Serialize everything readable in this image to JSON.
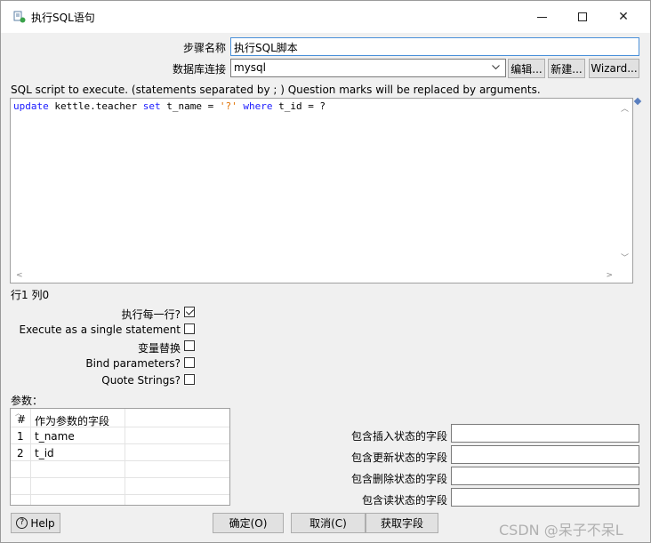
{
  "window": {
    "title": "执行SQL语句",
    "minimize_glyph": "—",
    "close_glyph": "✕"
  },
  "form": {
    "step_name_label": "步骤名称",
    "step_name_value": "执行SQL脚本",
    "db_conn_label": "数据库连接",
    "db_conn_value": "mysql",
    "edit_btn": "编辑...",
    "new_btn": "新建...",
    "wizard_btn": "Wizard..."
  },
  "sql": {
    "instruction": "SQL script to execute. (statements separated by ; ) Question marks will be replaced by arguments.",
    "line_parts": [
      {
        "text": "update",
        "kind": "kw"
      },
      {
        "text": " kettle.teacher ",
        "kind": "plain"
      },
      {
        "text": "set",
        "kind": "kw"
      },
      {
        "text": " t_name = ",
        "kind": "plain"
      },
      {
        "text": "'?'",
        "kind": "str"
      },
      {
        "text": " ",
        "kind": "plain"
      },
      {
        "text": "where",
        "kind": "kw"
      },
      {
        "text": " t_id = ?",
        "kind": "plain"
      }
    ],
    "position": "行1 列0"
  },
  "options": {
    "exec_each_row_label": "执行每一行?",
    "exec_each_row": true,
    "single_statement_label": "Execute as a single statement",
    "single_statement": false,
    "var_substitution_label": "变量替换",
    "var_substitution": false,
    "bind_params_label": "Bind parameters?",
    "bind_params": false,
    "quote_strings_label": "Quote Strings?",
    "quote_strings": false
  },
  "params": {
    "label": "参数：",
    "col_num": "#",
    "col_field": "作为参数的字段",
    "rows": [
      {
        "num": "1",
        "field": "t_name"
      },
      {
        "num": "2",
        "field": "t_id"
      }
    ]
  },
  "status_fields": {
    "insert_label": "包含插入状态的字段",
    "update_label": "包含更新状态的字段",
    "delete_label": "包含删除状态的字段",
    "read_label": "包含读状态的字段"
  },
  "buttons": {
    "help": "Help",
    "ok": "确定(O)",
    "cancel": "取消(C)",
    "get_fields": "获取字段"
  },
  "watermark": "CSDN @呆子不呆L",
  "colors": {
    "keyword": "#1a1aff",
    "string": "#e07000",
    "focus_border": "#4a90d9"
  }
}
